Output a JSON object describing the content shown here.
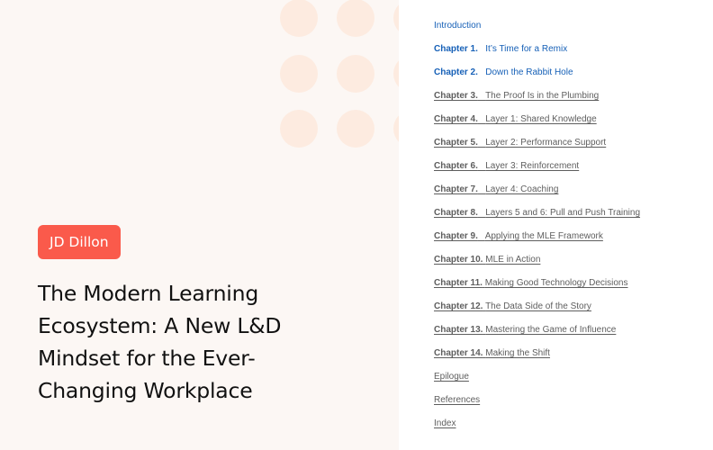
{
  "colors": {
    "badge_bg": "#fa5a4b",
    "left_bg": "#fcf7f4",
    "dot": "#fdebe0",
    "link_active": "#1660b7",
    "link_visited": "#5e5e5e"
  },
  "author": "JD Dillon",
  "book_title": "The Modern Learning Ecosystem: A New L&D Mindset for the Ever-Changing Workplace",
  "toc": [
    {
      "num": "",
      "title": "Introduction",
      "style": "blue"
    },
    {
      "num": "Chapter 1.",
      "title": "It’s Time for a Remix",
      "style": "blue"
    },
    {
      "num": "Chapter 2.",
      "title": "Down the Rabbit Hole",
      "style": "blue"
    },
    {
      "num": "Chapter 3.",
      "title": "The Proof Is in the Plumbing",
      "style": "gray"
    },
    {
      "num": "Chapter 4.",
      "title": "Layer 1: Shared Knowledge",
      "style": "gray"
    },
    {
      "num": "Chapter 5.",
      "title": "Layer 2: Performance Support",
      "style": "gray"
    },
    {
      "num": "Chapter 6.",
      "title": "Layer 3: Reinforcement",
      "style": "gray"
    },
    {
      "num": "Chapter 7.",
      "title": "Layer 4: Coaching",
      "style": "gray"
    },
    {
      "num": "Chapter 8.",
      "title": "Layers 5 and 6: Pull and Push Training",
      "style": "gray"
    },
    {
      "num": "Chapter 9.",
      "title": "Applying the MLE Framework",
      "style": "gray"
    },
    {
      "num": "Chapter 10.",
      "title": "MLE in Action",
      "style": "gray"
    },
    {
      "num": "Chapter 11.",
      "title": "Making Good Technology Decisions",
      "style": "gray"
    },
    {
      "num": "Chapter 12.",
      "title": "The Data Side of the Story",
      "style": "gray"
    },
    {
      "num": "Chapter 13.",
      "title": "Mastering the Game of Influence",
      "style": "gray"
    },
    {
      "num": "Chapter 14.",
      "title": "Making the Shift",
      "style": "gray"
    },
    {
      "num": "",
      "title": "Epilogue",
      "style": "gray"
    },
    {
      "num": "",
      "title": "References",
      "style": "gray"
    },
    {
      "num": "",
      "title": "Index",
      "style": "gray"
    }
  ]
}
